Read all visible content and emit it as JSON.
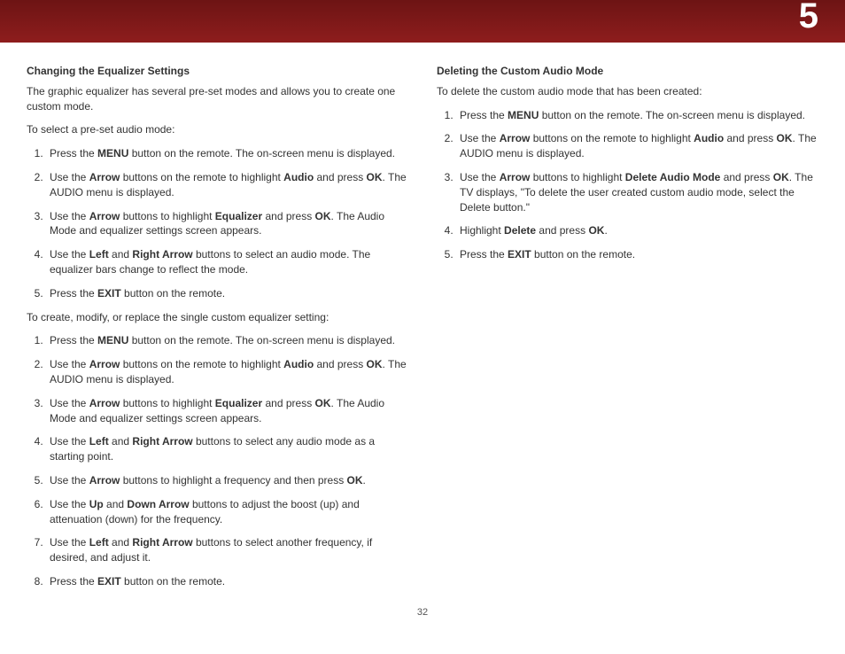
{
  "chapter": "5",
  "page_number": "32",
  "left": {
    "heading1": "Changing the Equalizer Settings",
    "intro1": "The graphic equalizer has several pre-set modes and allows you to create one custom mode.",
    "lead1": "To select a pre-set audio mode:",
    "list1": [
      {
        "pre": "Press the ",
        "b1": "MENU",
        "post": " button on the remote. The on-screen menu is displayed."
      },
      {
        "pre": "Use the ",
        "b1": "Arrow",
        "mid1": " buttons on the remote to highlight ",
        "b2": "Audio",
        "mid2": " and press ",
        "b3": "OK",
        "post": ". The AUDIO menu is displayed."
      },
      {
        "pre": "Use the ",
        "b1": "Arrow",
        "mid1": " buttons to highlight ",
        "b2": "Equalizer",
        "mid2": " and press ",
        "b3": "OK",
        "post": ". The Audio Mode and equalizer settings screen appears."
      },
      {
        "pre": "Use the ",
        "b1": "Left",
        "mid1": " and ",
        "b2": "Right Arrow",
        "post": " buttons to select an audio mode. The equalizer bars change to reflect the mode."
      },
      {
        "pre": "Press the ",
        "b1": "EXIT",
        "post": " button on the remote."
      }
    ],
    "lead2": "To create, modify, or replace the single custom equalizer setting:",
    "list2": [
      {
        "pre": "Press the ",
        "b1": "MENU",
        "post": " button on the remote. The on-screen menu is displayed."
      },
      {
        "pre": "Use the ",
        "b1": "Arrow",
        "mid1": " buttons on the remote to highlight ",
        "b2": "Audio",
        "mid2": " and press ",
        "b3": "OK",
        "post": ". The AUDIO menu is displayed."
      },
      {
        "pre": "Use the ",
        "b1": "Arrow",
        "mid1": " buttons to highlight ",
        "b2": "Equalizer",
        "mid2": " and press ",
        "b3": "OK",
        "post": ". The Audio Mode and equalizer settings screen appears."
      },
      {
        "pre": "Use the ",
        "b1": "Left",
        "mid1": " and ",
        "b2": "Right Arrow",
        "post": " buttons to select any audio mode as a starting point."
      },
      {
        "pre": "Use the ",
        "b1": "Arrow",
        "mid1": " buttons to highlight a frequency and then press ",
        "b2": "OK",
        "post": "."
      },
      {
        "pre": "Use the ",
        "b1": "Up",
        "mid1": " and ",
        "b2": "Down Arrow",
        "post": " buttons to adjust the boost (up) and attenuation (down) for the frequency."
      },
      {
        "pre": "Use the ",
        "b1": "Left",
        "mid1": " and ",
        "b2": "Right Arrow",
        "post": " buttons to select another frequency, if desired, and adjust it."
      },
      {
        "pre": "Press the ",
        "b1": "EXIT",
        "post": " button on the remote."
      }
    ]
  },
  "right": {
    "heading1": "Deleting the Custom Audio Mode",
    "intro1": "To delete the custom audio mode that has been created:",
    "list1": [
      {
        "pre": "Press the ",
        "b1": "MENU",
        "post": " button on the remote. The on-screen menu is displayed."
      },
      {
        "pre": "Use the ",
        "b1": "Arrow",
        "mid1": " buttons on the remote to highlight ",
        "b2": "Audio",
        "mid2": " and press ",
        "b3": "OK",
        "post": ". The AUDIO menu is displayed."
      },
      {
        "pre": "Use the ",
        "b1": "Arrow",
        "mid1": " buttons to highlight ",
        "b2": "Delete Audio Mode",
        "mid2": " and press ",
        "b3": "OK",
        "post": ". The TV displays, \"To delete the user created custom audio mode, select the Delete button.\""
      },
      {
        "pre": "Highlight ",
        "b1": "Delete",
        "mid1": " and press ",
        "b2": "OK",
        "post": "."
      },
      {
        "pre": "Press the ",
        "b1": "EXIT",
        "post": " button on the remote."
      }
    ]
  }
}
